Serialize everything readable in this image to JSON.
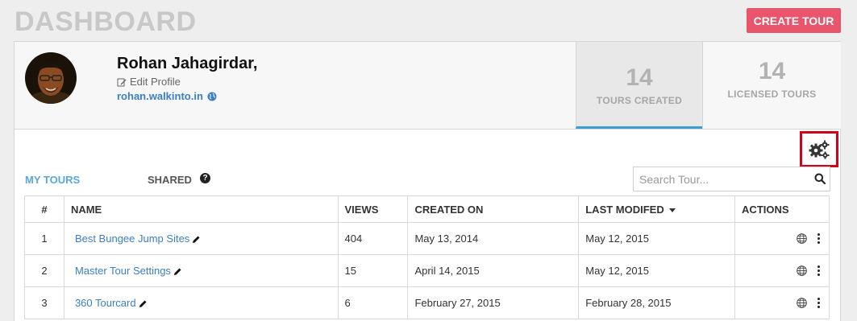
{
  "header": {
    "title": "DASHBOARD",
    "create_label": "CREATE TOUR"
  },
  "profile": {
    "name": "Rohan Jahagirdar,",
    "edit_label": "Edit Profile",
    "site": "rohan.walkinto.in",
    "stats": [
      {
        "value": "14",
        "label": "TOURS CREATED",
        "active": true
      },
      {
        "value": "14",
        "label": "LICENSED TOURS",
        "active": false
      }
    ]
  },
  "tabs": {
    "my_tours": "MY TOURS",
    "shared": "SHARED"
  },
  "search": {
    "placeholder": "Search Tour..."
  },
  "table": {
    "columns": [
      "#",
      "NAME",
      "VIEWS",
      "CREATED ON",
      "LAST MODIFED",
      "ACTIONS"
    ],
    "sorted_column": "LAST MODIFED",
    "rows": [
      {
        "num": "1",
        "name": "Best Bungee Jump Sites",
        "views": "404",
        "created": "May 13, 2014",
        "modified": "May 12, 2015"
      },
      {
        "num": "2",
        "name": "Master Tour Settings",
        "views": "15",
        "created": "April 14, 2015",
        "modified": "May 12, 2015"
      },
      {
        "num": "3",
        "name": "360 Tourcard",
        "views": "6",
        "created": "February 27, 2015",
        "modified": "February 28, 2015"
      }
    ]
  },
  "colors": {
    "accent": "#e9556a",
    "link": "#3b7fc4",
    "tab_active": "#5aa7d9",
    "highlight_box": "#d0021b"
  },
  "icons": [
    "edit-icon",
    "globe-icon",
    "gears-icon",
    "help-icon",
    "search-icon",
    "pencil-icon",
    "kebab-icon",
    "sort-caret-icon"
  ]
}
